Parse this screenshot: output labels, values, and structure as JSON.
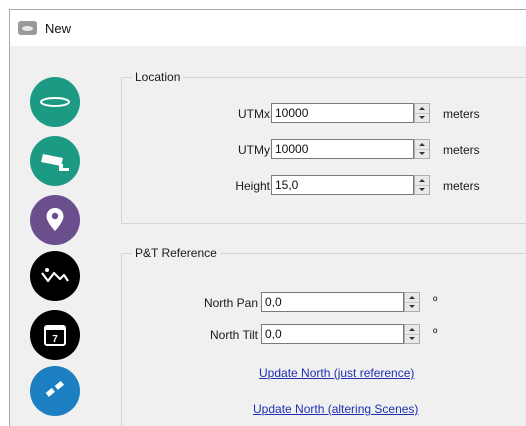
{
  "window": {
    "title": "New",
    "icon": "window-app-icon"
  },
  "sidebar": {
    "items": [
      {
        "name": "ring-view",
        "icon": "ring-icon",
        "color": "#1c9a84"
      },
      {
        "name": "camera",
        "icon": "cctv-camera-icon",
        "color": "#1c9a84"
      },
      {
        "name": "location",
        "icon": "map-pin-icon",
        "color": "#6b4e8c"
      },
      {
        "name": "terrain",
        "icon": "mountain-icon",
        "color": "#000000"
      },
      {
        "name": "calendar",
        "icon": "calendar-icon",
        "color": "#000000"
      },
      {
        "name": "satellite",
        "icon": "satellite-icon",
        "color": "#1b7fc2"
      }
    ]
  },
  "location": {
    "legend": "Location",
    "fields": [
      {
        "label": "UTMx",
        "value": "10000",
        "unit": "meters"
      },
      {
        "label": "UTMy",
        "value": "10000",
        "unit": "meters"
      },
      {
        "label": "Height",
        "value": "15,0",
        "unit": "meters"
      }
    ]
  },
  "pt_reference": {
    "legend": "P&T Reference",
    "fields": [
      {
        "label": "North Pan",
        "value": "0,0",
        "unit": "º"
      },
      {
        "label": "North Tilt",
        "value": "0,0",
        "unit": "º"
      }
    ],
    "links": {
      "update_north_reference": "Update North (just reference)",
      "update_north_scenes": "Update North (altering Scenes)"
    }
  }
}
